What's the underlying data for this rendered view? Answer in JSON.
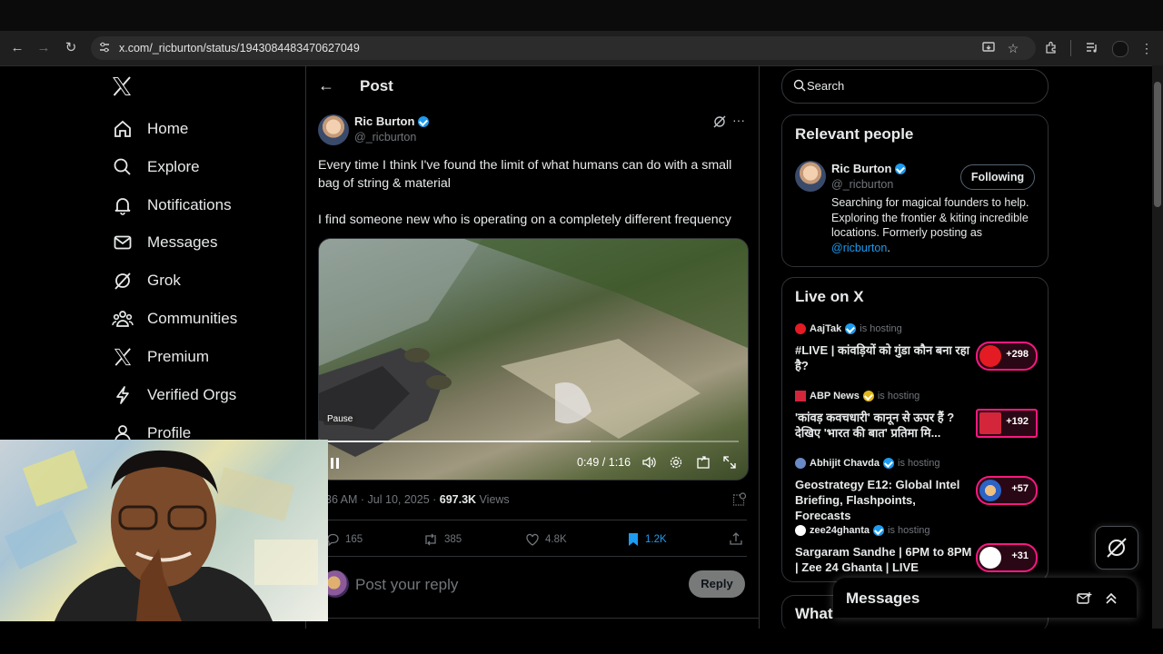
{
  "browser": {
    "url": "x.com/_ricburton/status/1943084483470627049"
  },
  "nav": {
    "items": [
      {
        "label": "Home"
      },
      {
        "label": "Explore"
      },
      {
        "label": "Notifications"
      },
      {
        "label": "Messages"
      },
      {
        "label": "Grok"
      },
      {
        "label": "Communities"
      },
      {
        "label": "Premium"
      },
      {
        "label": "Verified Orgs"
      },
      {
        "label": "Profile"
      }
    ]
  },
  "post": {
    "header_title": "Post",
    "author_name": "Ric Burton",
    "author_handle": "@_ricburton",
    "text_line1": "Every time I think I've found the limit of what humans can do with a small",
    "text_line2": "bag of string & material",
    "text_line3": "I find someone new who is operating on a completely different frequency",
    "video": {
      "tooltip": "Pause",
      "time": "0:49 / 1:16",
      "progress": 0.64
    },
    "meta_time": "36 AM · Jul 10, 2025 · ",
    "views_count": "697.3K",
    "views_label": " Views",
    "replies": "165",
    "reposts": "385",
    "likes": "4.8K",
    "bookmarks": "1.2K",
    "reply_placeholder": "Post your reply",
    "reply_button": "Reply"
  },
  "right": {
    "search_placeholder": "Search",
    "relevant": {
      "title": "Relevant people",
      "name": "Ric Burton",
      "handle": "@_ricburton",
      "follow_label": "Following",
      "bio": "Searching for magical founders to help. Exploring the frontier & kiting incredible locations. Formerly posting as ",
      "bio_link": "@ricburton",
      "bio_end": "."
    },
    "live": {
      "title": "Live on X",
      "items": [
        {
          "host": "AajTak",
          "hosting": "is hosting",
          "title": "#LIVE | कांवड़ियों को गुंडा कौन बना रहा है?",
          "count": "+298",
          "badge_color": "#e41b23"
        },
        {
          "host": "ABP News",
          "hosting": "is hosting",
          "title": "'कांवड़ कवचधारी' कानून से ऊपर हैं ? देखिए 'भारत की बात' प्रतिमा मि...",
          "count": "+192",
          "badge_color": "#d4263b"
        },
        {
          "host": "Abhijit Chavda",
          "hosting": "is hosting",
          "title": "Geostrategy E12: Global Intel Briefing, Flashpoints, Forecasts",
          "count": "+57",
          "badge_color": "#2b63c6"
        },
        {
          "host": "zee24ghanta",
          "hosting": "is hosting",
          "title": "Sargaram Sandhe | 6PM to 8PM | Zee 24 Ghanta | LIVE",
          "count": "+31",
          "badge_color": "#ffffff"
        }
      ]
    },
    "whats_happening": "What",
    "messages_label": "Messages"
  },
  "colors": {
    "accent": "#1d9bf0",
    "live": "#f91880"
  }
}
